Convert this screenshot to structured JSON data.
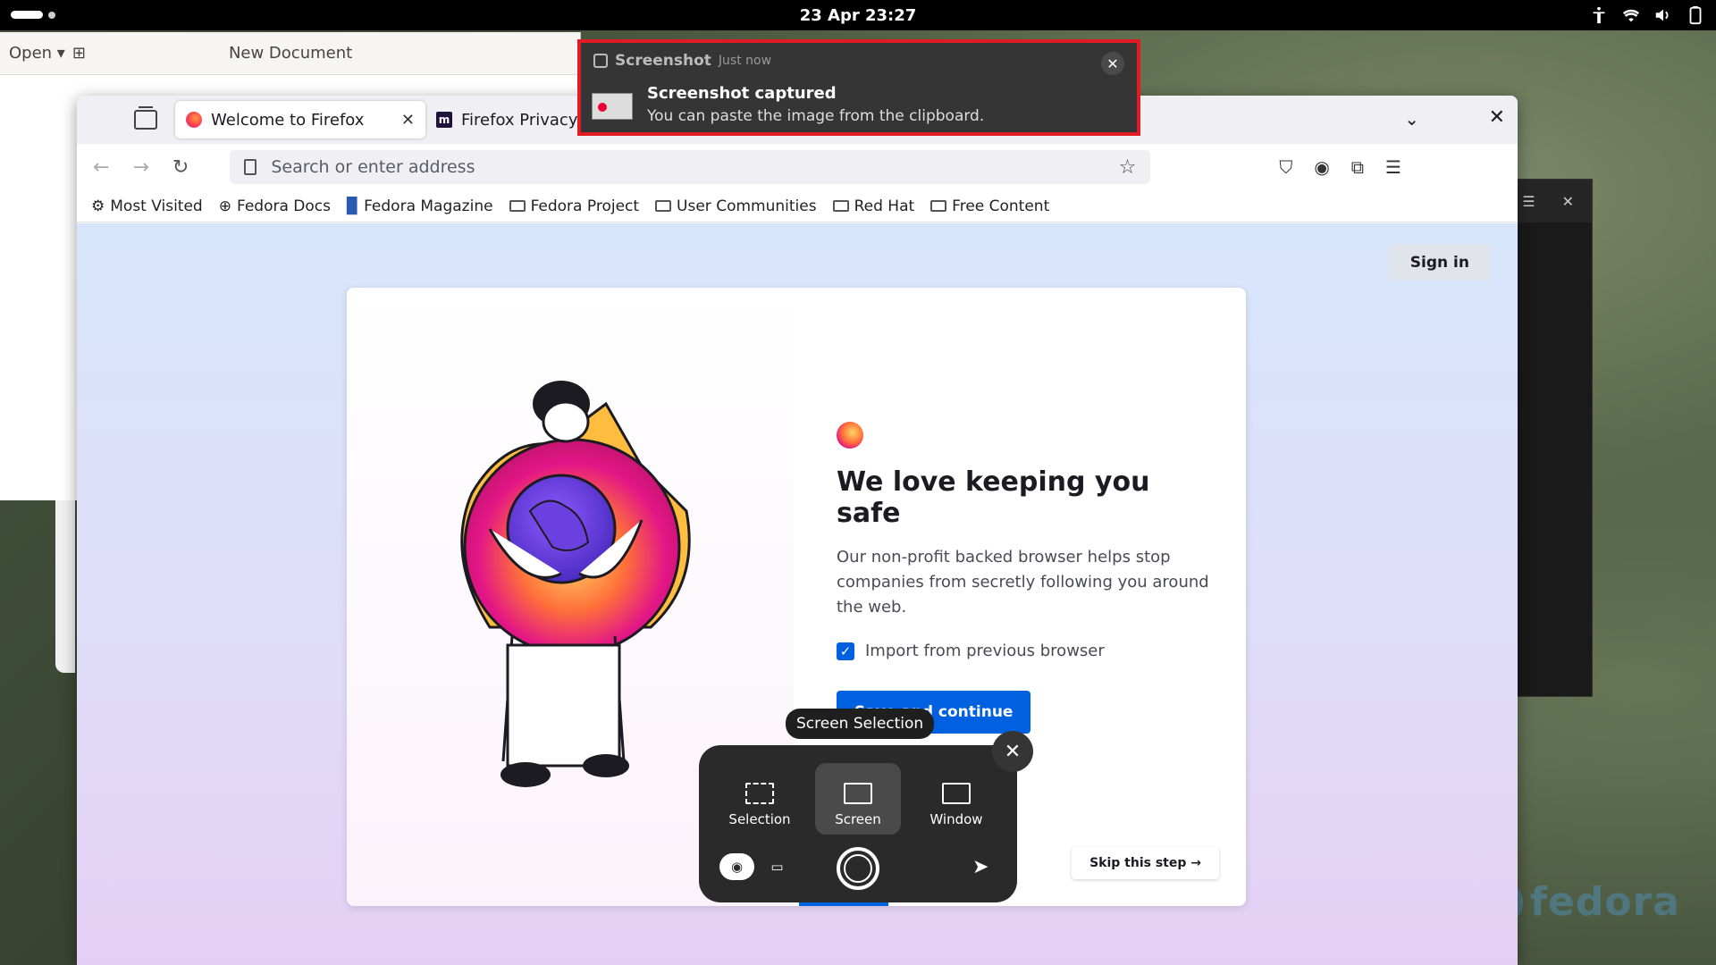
{
  "topbar": {
    "datetime": "23 Apr  23:27"
  },
  "editor": {
    "open_label": "Open",
    "title": "New Document"
  },
  "notification": {
    "app_name": "Screenshot",
    "time": "Just now",
    "title": "Screenshot captured",
    "body": "You can paste the image from the clipboard."
  },
  "firefox": {
    "tabs": [
      {
        "label": "Welcome to Firefox"
      },
      {
        "label": "Firefox Privacy N"
      }
    ],
    "urlbar_placeholder": "Search or enter address",
    "bookmarks": [
      {
        "label": "Most Visited",
        "icon": "gear-icon"
      },
      {
        "label": "Fedora Docs",
        "icon": "globe-icon"
      },
      {
        "label": "Fedora Magazine",
        "icon": "bookmark-icon"
      },
      {
        "label": "Fedora Project",
        "icon": "folder-icon"
      },
      {
        "label": "User Communities",
        "icon": "folder-icon"
      },
      {
        "label": "Red Hat",
        "icon": "folder-icon"
      },
      {
        "label": "Free Content",
        "icon": "folder-icon"
      }
    ],
    "sign_in": "Sign in",
    "welcome": {
      "headline": "We love keeping you safe",
      "description": "Our non-profit backed browser helps stop companies from secretly following you around the web.",
      "import_label": "Import from previous browser",
      "import_checked": true,
      "save_button": "Save and continue",
      "skip_button": "Skip this step →"
    }
  },
  "screenshot_tool": {
    "tooltip": "Screen Selection",
    "modes": [
      {
        "label": "Selection",
        "selected": false
      },
      {
        "label": "Screen",
        "selected": true
      },
      {
        "label": "Window",
        "selected": false
      }
    ],
    "capture_type": "screenshot"
  },
  "watermark": "fedora",
  "colors": {
    "accent": "#0061e0",
    "notification_border": "#e01b24"
  }
}
